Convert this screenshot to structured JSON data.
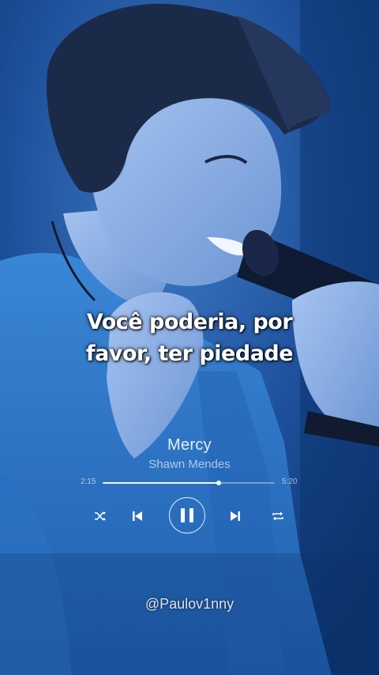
{
  "lyrics": {
    "line1": "Você poderia, por",
    "line2": "favor, ter piedade"
  },
  "player": {
    "title": "Mercy",
    "artist": "Shawn Mendes",
    "elapsed": "2:15",
    "total": "5:20",
    "progress": 0.675,
    "state": "playing",
    "controls": [
      "shuffle-icon",
      "previous-icon",
      "pause-icon",
      "next-icon",
      "repeat-icon"
    ]
  },
  "watermark": "@Paulov1nny",
  "colors": {
    "background": "#0b3a78",
    "sweater": "#2f79c9",
    "skin": "#8fb2e6",
    "hair": "#1c2a4a",
    "text": "#ffffff"
  }
}
